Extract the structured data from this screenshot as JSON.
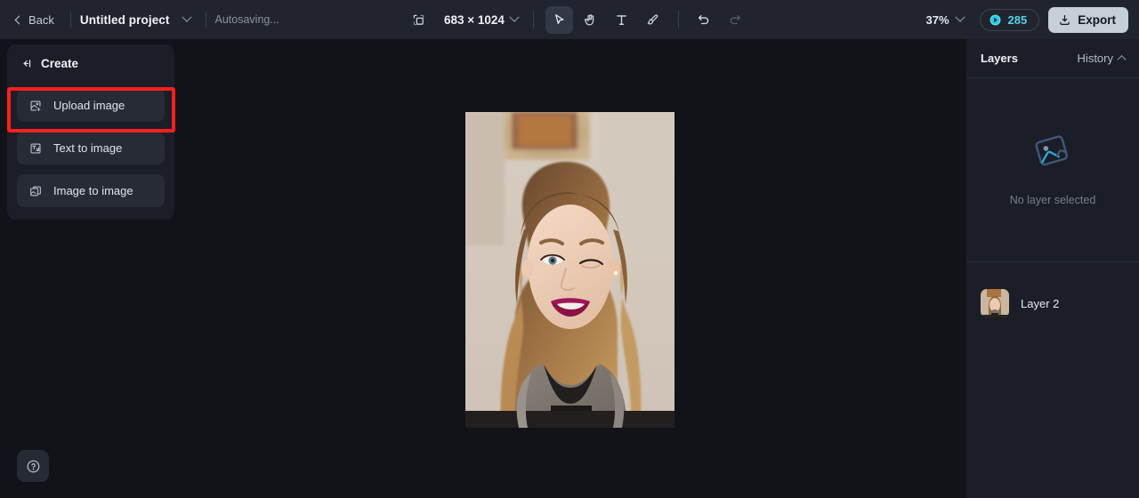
{
  "topbar": {
    "back_label": "Back",
    "project_title": "Untitled project",
    "project_caret_icon": "chevron-down-icon",
    "autosave_status": "Autosaving...",
    "resize_icon": "crop-resize-icon",
    "canvas_dimensions": "683 × 1024",
    "dimensions_caret_icon": "chevron-down-icon",
    "tools": [
      {
        "name": "select-tool",
        "icon": "cursor-arrow-icon",
        "active": true
      },
      {
        "name": "hand-tool",
        "icon": "hand-icon",
        "active": false
      },
      {
        "name": "text-tool",
        "icon": "text-t-icon",
        "active": false
      },
      {
        "name": "brush-tool",
        "icon": "paintbrush-icon",
        "active": false
      }
    ],
    "undo_icon": "undo-arrow-icon",
    "redo_icon": "redo-arrow-icon",
    "zoom_level": "37%",
    "zoom_caret_icon": "chevron-down-icon",
    "credits_icon": "credit-token-icon",
    "credits_value": "285",
    "export_icon": "download-icon",
    "export_label": "Export"
  },
  "left_panel": {
    "collapse_icon": "collapse-panel-icon",
    "title": "Create",
    "items": [
      {
        "label": "Upload image",
        "icon": "upload-image-icon",
        "highlighted": true
      },
      {
        "label": "Text to image",
        "icon": "text-to-image-icon",
        "highlighted": false
      },
      {
        "label": "Image to image",
        "icon": "image-to-image-icon",
        "highlighted": false
      }
    ],
    "help_icon": "question-circle-icon"
  },
  "right_panel": {
    "layers_tab_label": "Layers",
    "history_tab_label": "History",
    "history_caret_icon": "chevron-up-icon",
    "empty_icon": "image-placeholder-icon",
    "empty_label": "No layer selected",
    "layers": [
      {
        "name": "Layer 2",
        "thumbnail": "portrait-photo-thumbnail"
      }
    ]
  },
  "canvas": {
    "artboard_name": "portrait-photo-artboard",
    "artboard_alt": "Portrait photo of a smiling blonde woman winking"
  },
  "annotation": {
    "highlight_color": "#fc1f1f",
    "target": "Upload image"
  },
  "colors": {
    "app_background": "#121318",
    "topbar_background": "#21242e",
    "panel_background": "#1b1e27",
    "button_background": "#272b36",
    "accent_cyan": "#56d2e8",
    "export_button": "#c6ced8"
  }
}
